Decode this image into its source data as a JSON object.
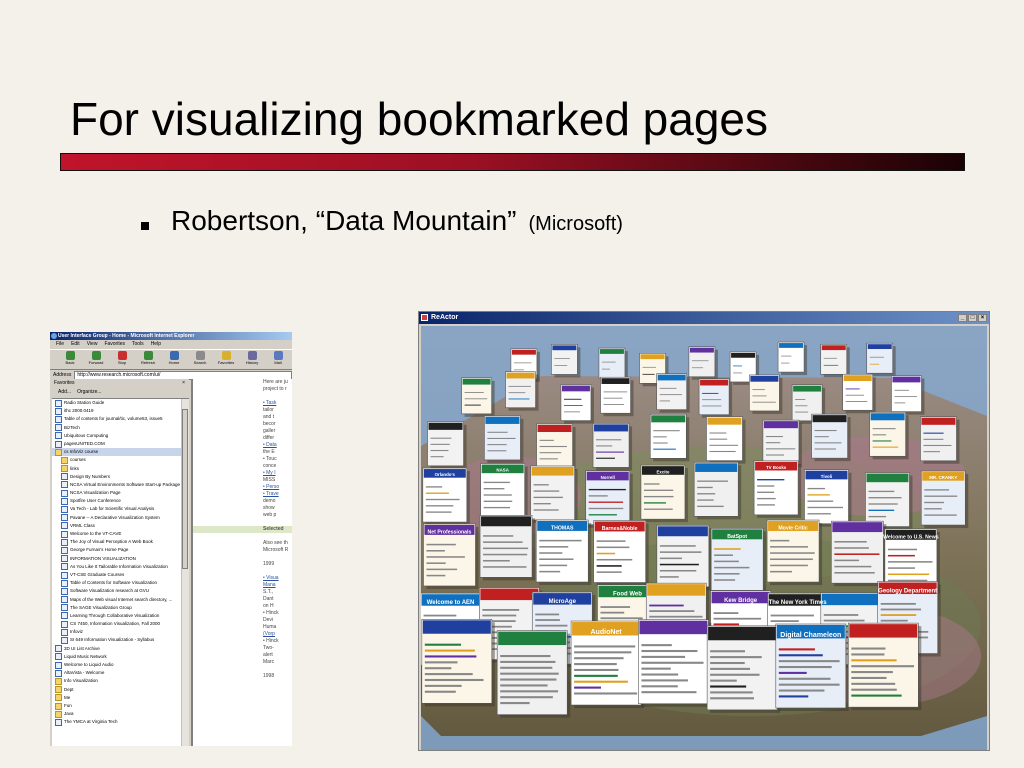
{
  "slide": {
    "title": "For visualizing bookmarked pages",
    "bullet": "Robertson, “Data Mountain”",
    "bullet_note": "(Microsoft)"
  },
  "colors": {
    "rule_start": "#c0142b",
    "rule_end": "#1a0205",
    "background": "#f3f1ea"
  },
  "ie_window": {
    "title": "User Interface Group - Home - Microsoft Internet Explorer",
    "menu": [
      "File",
      "Edit",
      "View",
      "Favorites",
      "Tools",
      "Help"
    ],
    "toolbar": [
      {
        "label": "Back",
        "icon": "back-arrow-icon"
      },
      {
        "label": "Forward",
        "icon": "forward-arrow-icon"
      },
      {
        "label": "Stop",
        "icon": "stop-icon"
      },
      {
        "label": "Refresh",
        "icon": "refresh-icon"
      },
      {
        "label": "Home",
        "icon": "home-icon"
      },
      {
        "label": "Search",
        "icon": "search-icon"
      },
      {
        "label": "Favorites",
        "icon": "favorites-icon"
      },
      {
        "label": "History",
        "icon": "history-icon"
      },
      {
        "label": "Mail",
        "icon": "mail-icon"
      }
    ],
    "address_label": "Address",
    "address_value": "http://www.research.microsoft.com/ui/",
    "favorites_label": "Favorites",
    "favorites_close": "×",
    "add_label": "Add...",
    "organize_label": "Organize...",
    "favorites": [
      {
        "label": "Radio Station Guide",
        "type": "page"
      },
      {
        "label": "ithc 2000.0419",
        "type": "page"
      },
      {
        "label": "Table of contents for journal/tic, volume53, issue5",
        "type": "page"
      },
      {
        "label": "BizTech",
        "type": "page"
      },
      {
        "label": "Ubiquitous Computing",
        "type": "page"
      },
      {
        "label": "pagesUNITED.COM",
        "type": "page"
      },
      {
        "label": "cs InfoViz course",
        "type": "folder",
        "selected": true
      },
      {
        "label": "courses",
        "type": "folder",
        "indent": true
      },
      {
        "label": "links",
        "type": "folder",
        "indent": true
      },
      {
        "label": "Design By Numbers",
        "type": "page",
        "indent": true
      },
      {
        "label": "NCSA Virtual Environments Software Start-up Package",
        "type": "page",
        "indent": true
      },
      {
        "label": "NCSA Visualization Page",
        "type": "page",
        "indent": true
      },
      {
        "label": "Spotfire User Conference",
        "type": "page",
        "indent": true
      },
      {
        "label": "Va Tech - Lab for Scientific Visual Analysis",
        "type": "page",
        "indent": true
      },
      {
        "label": "Pavane -- A Declarative Visualization System",
        "type": "page",
        "indent": true
      },
      {
        "label": "VRML Class",
        "type": "page",
        "indent": true
      },
      {
        "label": "Welcome to the VT-CAVE",
        "type": "page",
        "indent": true
      },
      {
        "label": "The Joy of Visual Perception A Web Book",
        "type": "page",
        "indent": true
      },
      {
        "label": "George Furnas's Home Page",
        "type": "page",
        "indent": true
      },
      {
        "label": "INFORMATION VISUALIZATION",
        "type": "page",
        "indent": true
      },
      {
        "label": "As You Like It Tailorable Information Visualization",
        "type": "page",
        "indent": true
      },
      {
        "label": "VT-CSE Graduate Courses",
        "type": "page",
        "indent": true
      },
      {
        "label": "Table of Contents for Software Visualization",
        "type": "page",
        "indent": true
      },
      {
        "label": "Software Visualization research at GVU",
        "type": "page",
        "indent": true
      },
      {
        "label": "Maps of the Web visual Internet search directory, ...",
        "type": "page",
        "indent": true
      },
      {
        "label": "The SAGE Visualization Group",
        "type": "page",
        "indent": true
      },
      {
        "label": "Learning Through Collaborative Visualization",
        "type": "page",
        "indent": true
      },
      {
        "label": "CS 7450, Information Visualization, Fall 2000",
        "type": "page",
        "indent": true
      },
      {
        "label": "Infoviz",
        "type": "page",
        "indent": true
      },
      {
        "label": "SI 649 Information Visualization - Syllabus",
        "type": "page",
        "indent": true
      },
      {
        "label": "3D UI List Archive",
        "type": "page"
      },
      {
        "label": "Liquid Music Network",
        "type": "page"
      },
      {
        "label": "Welcome to Liquid Audio",
        "type": "page"
      },
      {
        "label": "AltaVista - Welcome",
        "type": "page"
      },
      {
        "label": "Info Visualization",
        "type": "folder"
      },
      {
        "label": "Dept",
        "type": "folder"
      },
      {
        "label": "Me",
        "type": "folder"
      },
      {
        "label": "Fun",
        "type": "folder"
      },
      {
        "label": "Java",
        "type": "folder"
      },
      {
        "label": "The YMCA at Virginia Tech",
        "type": "page"
      }
    ],
    "content_lines": [
      {
        "text": "Here are ju",
        "style": "plain"
      },
      {
        "text": "project to r",
        "style": "plain"
      },
      {
        "text": "",
        "style": "plain"
      },
      {
        "text": "• Task",
        "style": "link"
      },
      {
        "text": "tailor",
        "style": "plain"
      },
      {
        "text": "and t",
        "style": "plain"
      },
      {
        "text": "becor",
        "style": "plain"
      },
      {
        "text": "galler",
        "style": "plain"
      },
      {
        "text": "differ",
        "style": "plain"
      },
      {
        "text": "• Data",
        "style": "link"
      },
      {
        "text": "the E",
        "style": "plain"
      },
      {
        "text": "• Touc",
        "style": "plain"
      },
      {
        "text": "conce",
        "style": "plain"
      },
      {
        "text": "• My I",
        "style": "link"
      },
      {
        "text": "MISS",
        "style": "plain"
      },
      {
        "text": "• Perso",
        "style": "link"
      },
      {
        "text": "• Trave",
        "style": "link"
      },
      {
        "text": "demo",
        "style": "plain"
      },
      {
        "text": "show",
        "style": "plain"
      },
      {
        "text": "web p",
        "style": "plain"
      },
      {
        "text": "",
        "style": "plain"
      },
      {
        "text": "Selected",
        "style": "highlight"
      },
      {
        "text": "",
        "style": "plain"
      },
      {
        "text": "Also see th",
        "style": "plain"
      },
      {
        "text": "Microsoft R",
        "style": "plain"
      },
      {
        "text": "",
        "style": "plain"
      },
      {
        "text": "1999",
        "style": "plain"
      },
      {
        "text": "",
        "style": "plain"
      },
      {
        "text": "• Visua",
        "style": "link"
      },
      {
        "text": "Mana",
        "style": "link"
      },
      {
        "text": "S.T.,",
        "style": "plain"
      },
      {
        "text": "Dant",
        "style": "plain"
      },
      {
        "text": "on H",
        "style": "plain"
      },
      {
        "text": "• Hinck",
        "style": "plain"
      },
      {
        "text": "Devi",
        "style": "plain"
      },
      {
        "text": "Huma",
        "style": "plain"
      },
      {
        "text": "(Vorp",
        "style": "link"
      },
      {
        "text": "• Hinck",
        "style": "plain"
      },
      {
        "text": "Two-",
        "style": "plain"
      },
      {
        "text": "alert",
        "style": "plain"
      },
      {
        "text": "Marc",
        "style": "plain"
      },
      {
        "text": "",
        "style": "plain"
      },
      {
        "text": "1998",
        "style": "plain"
      }
    ]
  },
  "reactor_window": {
    "title": "ReActor",
    "controls": [
      "_",
      "□",
      "×"
    ],
    "thumb_labels": [
      "Orlando's",
      "Norrell",
      "TV Books",
      "MR. CRANKY",
      "THOMAS",
      "BatSpot",
      "Welcome to U.S. News",
      "MicroAge",
      "Kew Bridge",
      "Geology Department",
      "AudioNet",
      "Digital Chameleon",
      "NASA",
      "Excite",
      "Tivoli",
      "Net Professionals",
      "Barnes&Noble",
      "Movie Critic",
      "Welcome to AEN",
      "Food Web",
      "The New York Times"
    ]
  }
}
